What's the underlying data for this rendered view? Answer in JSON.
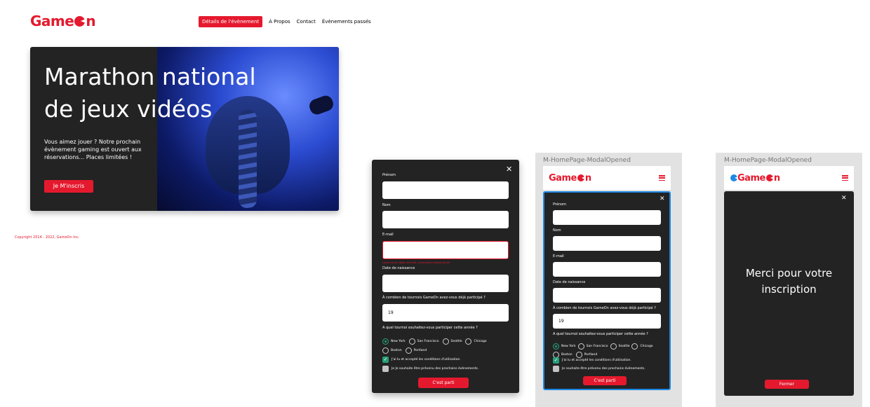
{
  "brand": {
    "name_prefix": "Game",
    "name_suffix": "n",
    "color": "#e5192e"
  },
  "nav": {
    "items": [
      "Détails de l'évènement",
      "À Propos",
      "Contact",
      "Évènements passés"
    ]
  },
  "hero": {
    "title": "Marathon national de jeux vidéos",
    "text": "Vous aimez jouer ? Notre prochain évènement gaming est ouvert aux réservations... Places limitées !",
    "cta": "Je M'inscris"
  },
  "footer": {
    "copyright": "Copyright 2014 - 2022, GameOn Inc."
  },
  "form": {
    "first_name_label": "Prénom",
    "last_name_label": "Nom",
    "email_label": "E-mail",
    "email_error": "Lorem ipsum dolor sit amet, consectetur adipiscing elit",
    "birthdate_label": "Date de naissance",
    "tournaments_label": "À combien de tournois GameOn avez-vous déjà participé ?",
    "tournaments_value": "19",
    "location_label": "A quel tournoi souhaitez-vous participer cette année ?",
    "locations": [
      "New York",
      "San Francisco",
      "Seattle",
      "Chicago",
      "Boston",
      "Portland"
    ],
    "selected_location": "New York",
    "terms_label": "J'ai lu et accepté les conditions d'utilisation.",
    "newsletter_label": "Je Je souhaite être prévenu des prochains évènements.",
    "newsletter_label_mobile": "Je souhaite être prévenu des prochains évènements.",
    "submit": "C'est parti"
  },
  "mobile_frames": {
    "title": "M-HomePage-ModalOpened",
    "confirmation": "Merci pour votre inscription",
    "close_button": "Fermer"
  }
}
